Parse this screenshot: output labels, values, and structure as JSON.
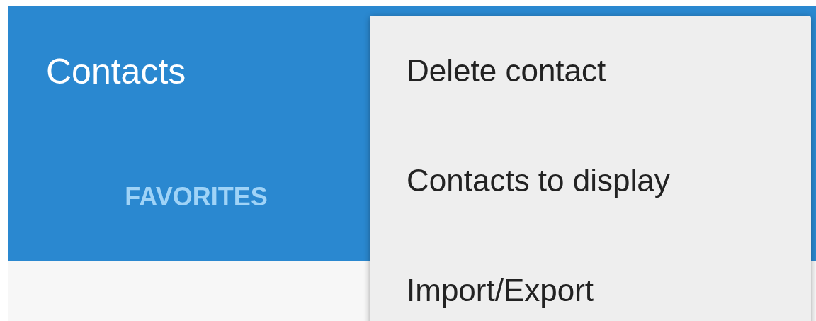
{
  "app_bar": {
    "title": "Contacts"
  },
  "tabs": [
    {
      "label": "FAVORITES",
      "selected": false
    }
  ],
  "menu": {
    "items": [
      {
        "label": "Delete contact"
      },
      {
        "label": "Contacts to display"
      },
      {
        "label": "Import/Export"
      }
    ]
  }
}
